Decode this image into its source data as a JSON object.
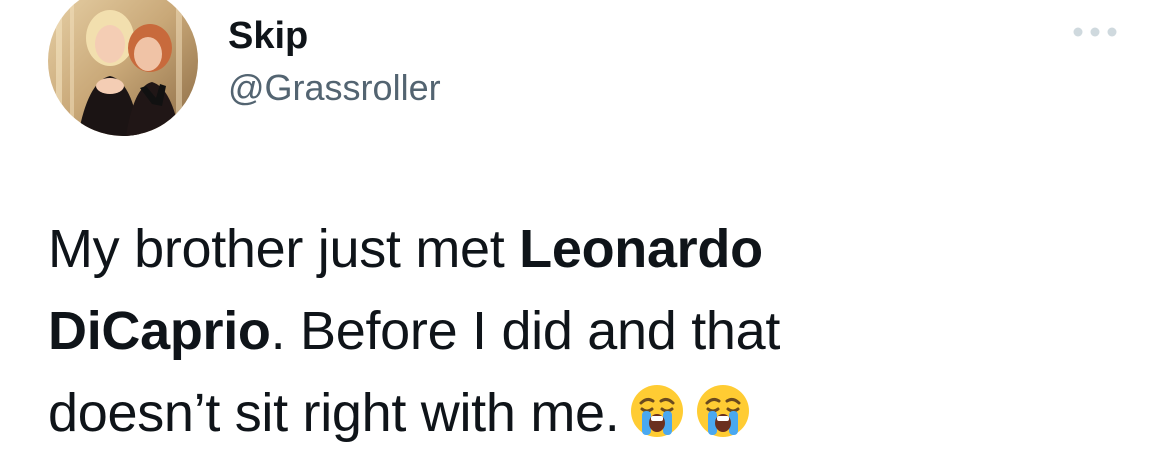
{
  "author": {
    "display_name": "Skip",
    "handle": "@Grassroller",
    "avatar_icon": "profile-photo-avatar"
  },
  "menu": {
    "more_icon": "more-horizontal-icon"
  },
  "tweet": {
    "text_part1": "My brother just met ",
    "mention_bold_line1": "Leonardo",
    "mention_bold_line2": "DiCaprio",
    "text_part2": ". Before I did and that",
    "text_part3": "doesn’t sit right with me.",
    "emojis": [
      "loudly-crying-face-emoji",
      "loudly-crying-face-emoji"
    ]
  },
  "colors": {
    "text_primary": "#0f1419",
    "text_secondary": "#536471",
    "more_dots": "#cfd9de"
  }
}
